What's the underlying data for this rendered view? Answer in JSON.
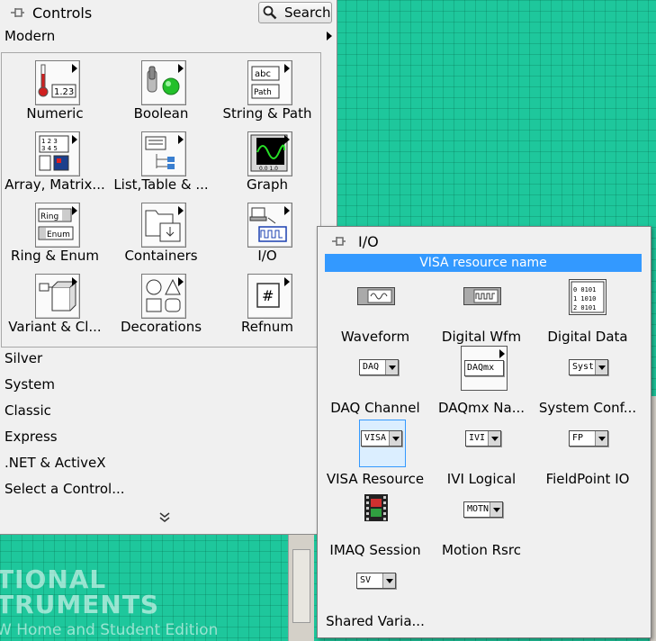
{
  "background": {
    "logo_line1": "TIONAL",
    "logo_line2": "TRUMENTS",
    "logo_line3": "W Home and Student Edition"
  },
  "controls_palette": {
    "title": "Controls",
    "search_label": "Search",
    "modern_label": "Modern",
    "tiles": [
      {
        "label": "Numeric",
        "icon": "numeric-icon"
      },
      {
        "label": "Boolean",
        "icon": "boolean-icon"
      },
      {
        "label": "String & Path",
        "icon": "string-path-icon"
      },
      {
        "label": "Array, Matrix...",
        "icon": "array-matrix-icon"
      },
      {
        "label": "List,Table & ...",
        "icon": "list-table-icon"
      },
      {
        "label": "Graph",
        "icon": "graph-icon"
      },
      {
        "label": "Ring & Enum",
        "icon": "ring-enum-icon"
      },
      {
        "label": "Containers",
        "icon": "containers-icon"
      },
      {
        "label": "I/O",
        "icon": "io-icon"
      },
      {
        "label": "Variant & Cl...",
        "icon": "variant-class-icon"
      },
      {
        "label": "Decorations",
        "icon": "decorations-icon"
      },
      {
        "label": "Refnum",
        "icon": "refnum-icon"
      }
    ],
    "categories": [
      "Silver",
      "System",
      "Classic",
      "Express",
      ".NET & ActiveX",
      "Select a Control..."
    ]
  },
  "io_palette": {
    "title": "I/O",
    "highlight": "VISA resource name",
    "tiles": [
      {
        "label": "Waveform",
        "icon": "waveform-icon"
      },
      {
        "label": "Digital Wfm",
        "icon": "digital-waveform-icon"
      },
      {
        "label": "Digital Data",
        "icon": "digital-data-icon",
        "bits": [
          "0 0101",
          "1 1010",
          "2 0101"
        ]
      },
      {
        "label": "DAQ Channel",
        "icon": "daq-channel-icon",
        "text": "DAQ"
      },
      {
        "label": "DAQmx Na...",
        "icon": "daqmx-name-icon",
        "text": "DAQmx"
      },
      {
        "label": "System Conf...",
        "icon": "system-config-icon",
        "text": "Syst"
      },
      {
        "label": "VISA Resource",
        "icon": "visa-resource-icon",
        "text": "VISA"
      },
      {
        "label": "IVI Logical",
        "icon": "ivi-logical-icon",
        "text": "IVI"
      },
      {
        "label": "FieldPoint IO",
        "icon": "fieldpoint-icon",
        "text": "FP"
      },
      {
        "label": "IMAQ Session",
        "icon": "imaq-session-icon"
      },
      {
        "label": "Motion Rsrc",
        "icon": "motion-resource-icon",
        "text": "MOTN"
      },
      {
        "label": "Shared Varia...",
        "icon": "shared-variable-icon",
        "text": "SV"
      }
    ]
  },
  "colors": {
    "panel_bg": "#f0f0f0",
    "canvas_green": "#1ec79c",
    "highlight_blue": "#3399ff"
  }
}
